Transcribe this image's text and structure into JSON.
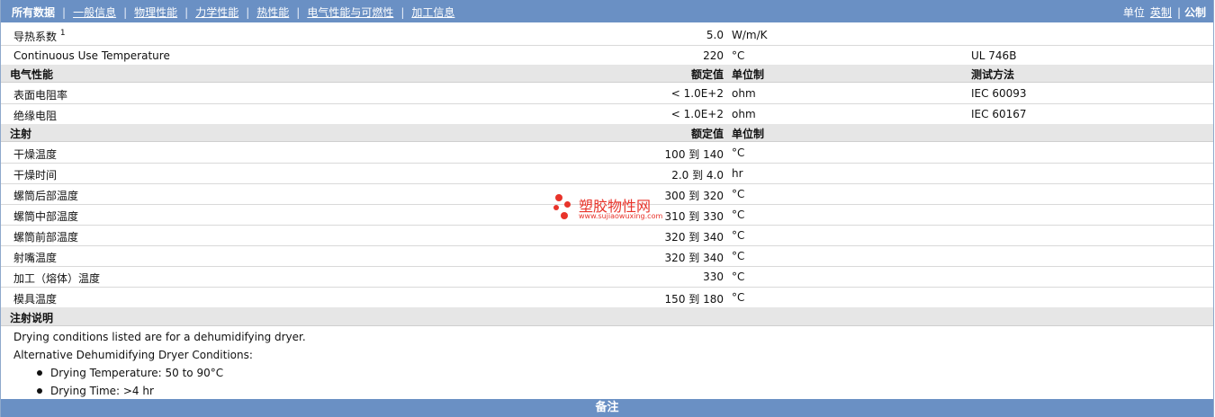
{
  "nav": {
    "tabs": [
      {
        "label": "所有数据",
        "active": true
      },
      {
        "label": "一般信息"
      },
      {
        "label": "物理性能"
      },
      {
        "label": "力学性能"
      },
      {
        "label": "热性能"
      },
      {
        "label": "电气性能与可燃性"
      },
      {
        "label": "加工信息"
      }
    ],
    "units_label": "单位",
    "unit_english": "英制",
    "unit_metric": "公制"
  },
  "thermal_rows": [
    {
      "name": "导热系数",
      "sup": "1",
      "value": "5.0",
      "unit": "W/m/K",
      "test": ""
    },
    {
      "name": "Continuous Use Temperature",
      "value": "220",
      "unit": "°C",
      "test": "UL 746B"
    }
  ],
  "electrical": {
    "header": {
      "name": "电气性能",
      "value": "额定值",
      "unit": "单位制",
      "test": "测试方法"
    },
    "rows": [
      {
        "name": "表面电阻率",
        "value": "< 1.0E+2",
        "unit": "ohm",
        "test": "IEC 60093"
      },
      {
        "name": "绝缘电阻",
        "value": "< 1.0E+2",
        "unit": "ohm",
        "test": "IEC 60167"
      }
    ]
  },
  "injection": {
    "header": {
      "name": "注射",
      "value": "额定值",
      "unit": "单位制"
    },
    "rows": [
      {
        "name": "干燥温度",
        "value": "100 到  140",
        "unit": "°C"
      },
      {
        "name": "干燥时间",
        "value": "2.0 到  4.0",
        "unit": "hr"
      },
      {
        "name": "螺筒后部温度",
        "value": "300 到  320",
        "unit": "°C"
      },
      {
        "name": "螺筒中部温度",
        "value": "310 到  330",
        "unit": "°C"
      },
      {
        "name": "螺筒前部温度",
        "value": "320 到  340",
        "unit": "°C"
      },
      {
        "name": "射嘴温度",
        "value": "320 到  340",
        "unit": "°C"
      },
      {
        "name": "加工（熔体）温度",
        "value": "330",
        "unit": "°C"
      },
      {
        "name": "模具温度",
        "value": "150 到  180",
        "unit": "°C"
      }
    ]
  },
  "injection_notes": {
    "header": "注射说明",
    "line1": "Drying conditions listed are for a dehumidifying dryer.",
    "line2": "Alternative Dehumidifying Dryer Conditions:",
    "bullets": [
      "Drying Temperature: 50 to 90°C",
      "Drying Time: >4 hr"
    ]
  },
  "remarks_header": "备注",
  "watermark": {
    "title": "塑胶物性网",
    "url": "www.sujiaowuxing.com",
    "color": "#e8332a"
  },
  "colors": {
    "nav_bg": "#6a90c4",
    "section_bg": "#e6e6e6"
  }
}
